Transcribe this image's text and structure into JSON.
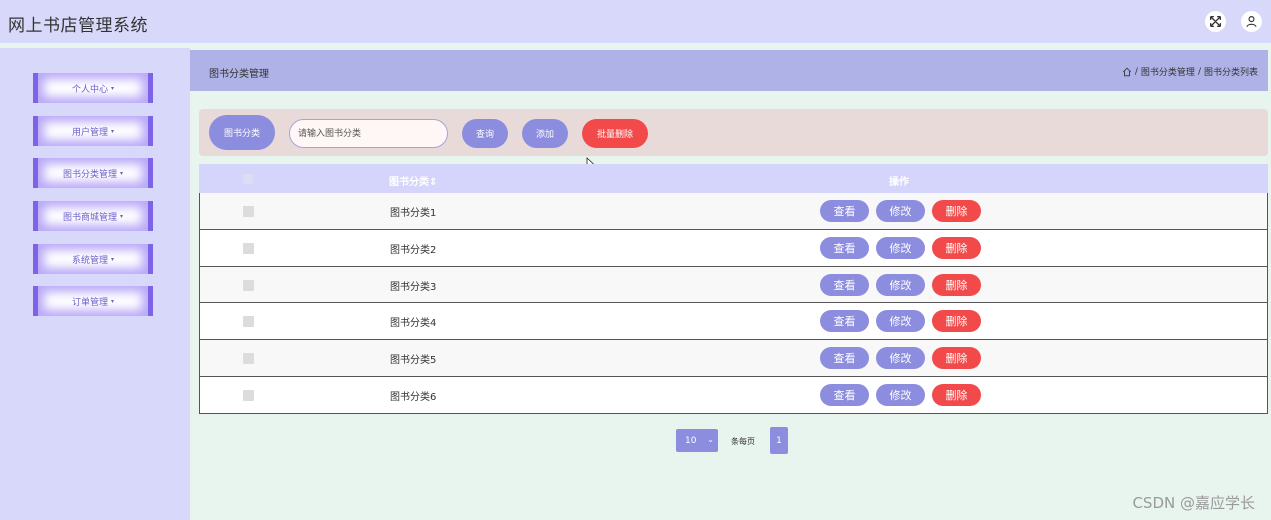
{
  "header": {
    "title": "网上书店管理系统",
    "icons": [
      "fullscreen-icon",
      "user-icon"
    ]
  },
  "sidebar": {
    "items": [
      {
        "label": "个人中心"
      },
      {
        "label": "用户管理"
      },
      {
        "label": "图书分类管理"
      },
      {
        "label": "图书商城管理"
      },
      {
        "label": "系统管理"
      },
      {
        "label": "订单管理"
      }
    ],
    "caret": "▾"
  },
  "page": {
    "title": "图书分类管理",
    "breadcrumb": [
      "图书分类管理",
      "图书分类列表"
    ],
    "separator": "/"
  },
  "search": {
    "label": "图书分类",
    "placeholder": "请输入图书分类",
    "query_button": "查询",
    "add_button": "添加",
    "batch_delete_button": "批量删除"
  },
  "table": {
    "columns": [
      "图书分类",
      "操作"
    ],
    "sort_mark": "⇕",
    "rows": [
      {
        "name": "图书分类1"
      },
      {
        "name": "图书分类2"
      },
      {
        "name": "图书分类3"
      },
      {
        "name": "图书分类4"
      },
      {
        "name": "图书分类5"
      },
      {
        "name": "图书分类6"
      }
    ],
    "actions": {
      "view": "查看",
      "edit": "修改",
      "delete": "删除"
    }
  },
  "pagination": {
    "page_size": "10",
    "per_page_label": "条每页",
    "current_page": "1"
  },
  "watermark": "CSDN @嘉应学长",
  "colors": {
    "accent": "#8c8dde",
    "danger": "#f24a4a",
    "sidebar_bg": "#d8d8fb",
    "content_bg": "#e8f4ee"
  }
}
